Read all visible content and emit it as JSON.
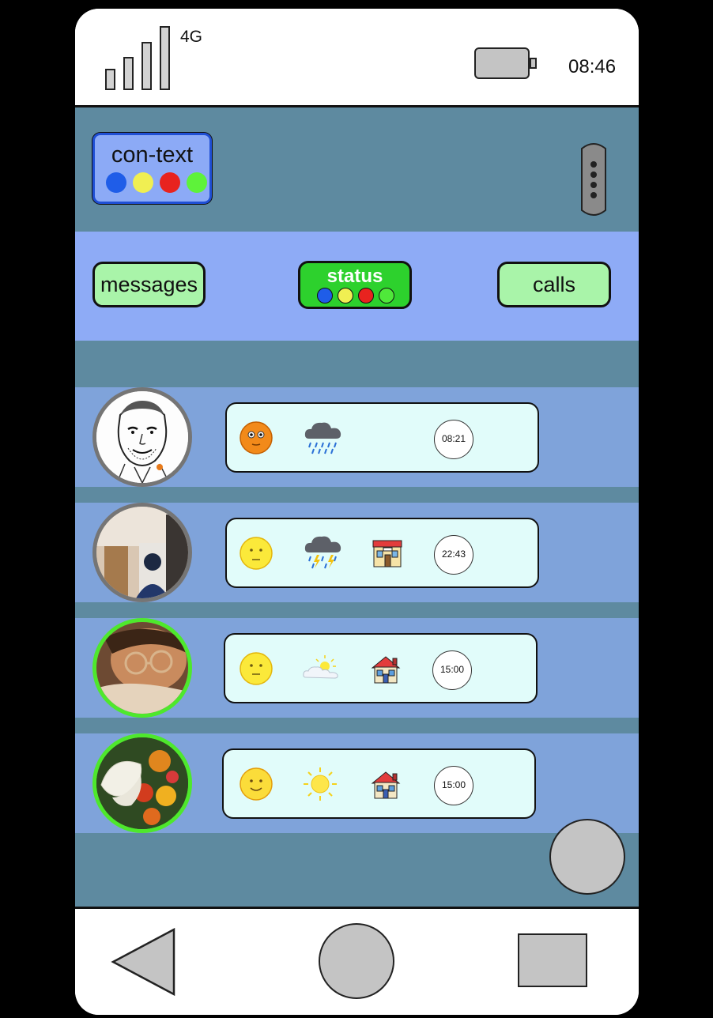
{
  "status_bar": {
    "network": "4G",
    "time": "08:46",
    "icons": [
      "signal-bars-icon",
      "battery-icon"
    ]
  },
  "header": {
    "logo_text": "con-text",
    "logo_dot_colors": [
      "#1f5de8",
      "#f0ef52",
      "#e8231f",
      "#5ef23a"
    ],
    "menu_icon": "vertical-dots-icon"
  },
  "tabs": {
    "messages": "messages",
    "status": "status",
    "calls": "calls",
    "status_dot_colors": [
      "#1f5de8",
      "#f0ef52",
      "#e8231f",
      "#4fe83a"
    ],
    "active": "status"
  },
  "contacts": [
    {
      "avatar": "sketch-portrait",
      "ring_color": "#757575",
      "mood": "orange-face-icon",
      "weather": "rain-cloud-icon",
      "location": "",
      "time": "08:21"
    },
    {
      "avatar": "photo-person-indoor",
      "ring_color": "#757575",
      "mood": "neutral-face-icon",
      "weather": "thunderstorm-icon",
      "location": "shop-icon",
      "time": "22:43"
    },
    {
      "avatar": "photo-child-glasses",
      "ring_color": "#4ee82c",
      "mood": "neutral-face-icon",
      "weather": "partly-cloudy-icon",
      "location": "house-icon",
      "time": "15:00"
    },
    {
      "avatar": "photo-butterfly-flowers",
      "ring_color": "#4ee82c",
      "mood": "smiling-face-icon",
      "weather": "sun-icon",
      "location": "house-icon",
      "time": "15:00"
    }
  ],
  "colors": {
    "frame": "#000000",
    "header_bg": "#5e8aa0",
    "tabs_bg": "#8eabf6",
    "row_bg": "#7fa3da",
    "card_bg": "#e1fcfa",
    "tab_bg": "#a9f4a9",
    "tab_active_bg": "#2dd12d"
  },
  "nav_bar": {
    "icons": [
      "back-triangle-icon",
      "home-circle-icon",
      "recent-square-icon"
    ]
  }
}
